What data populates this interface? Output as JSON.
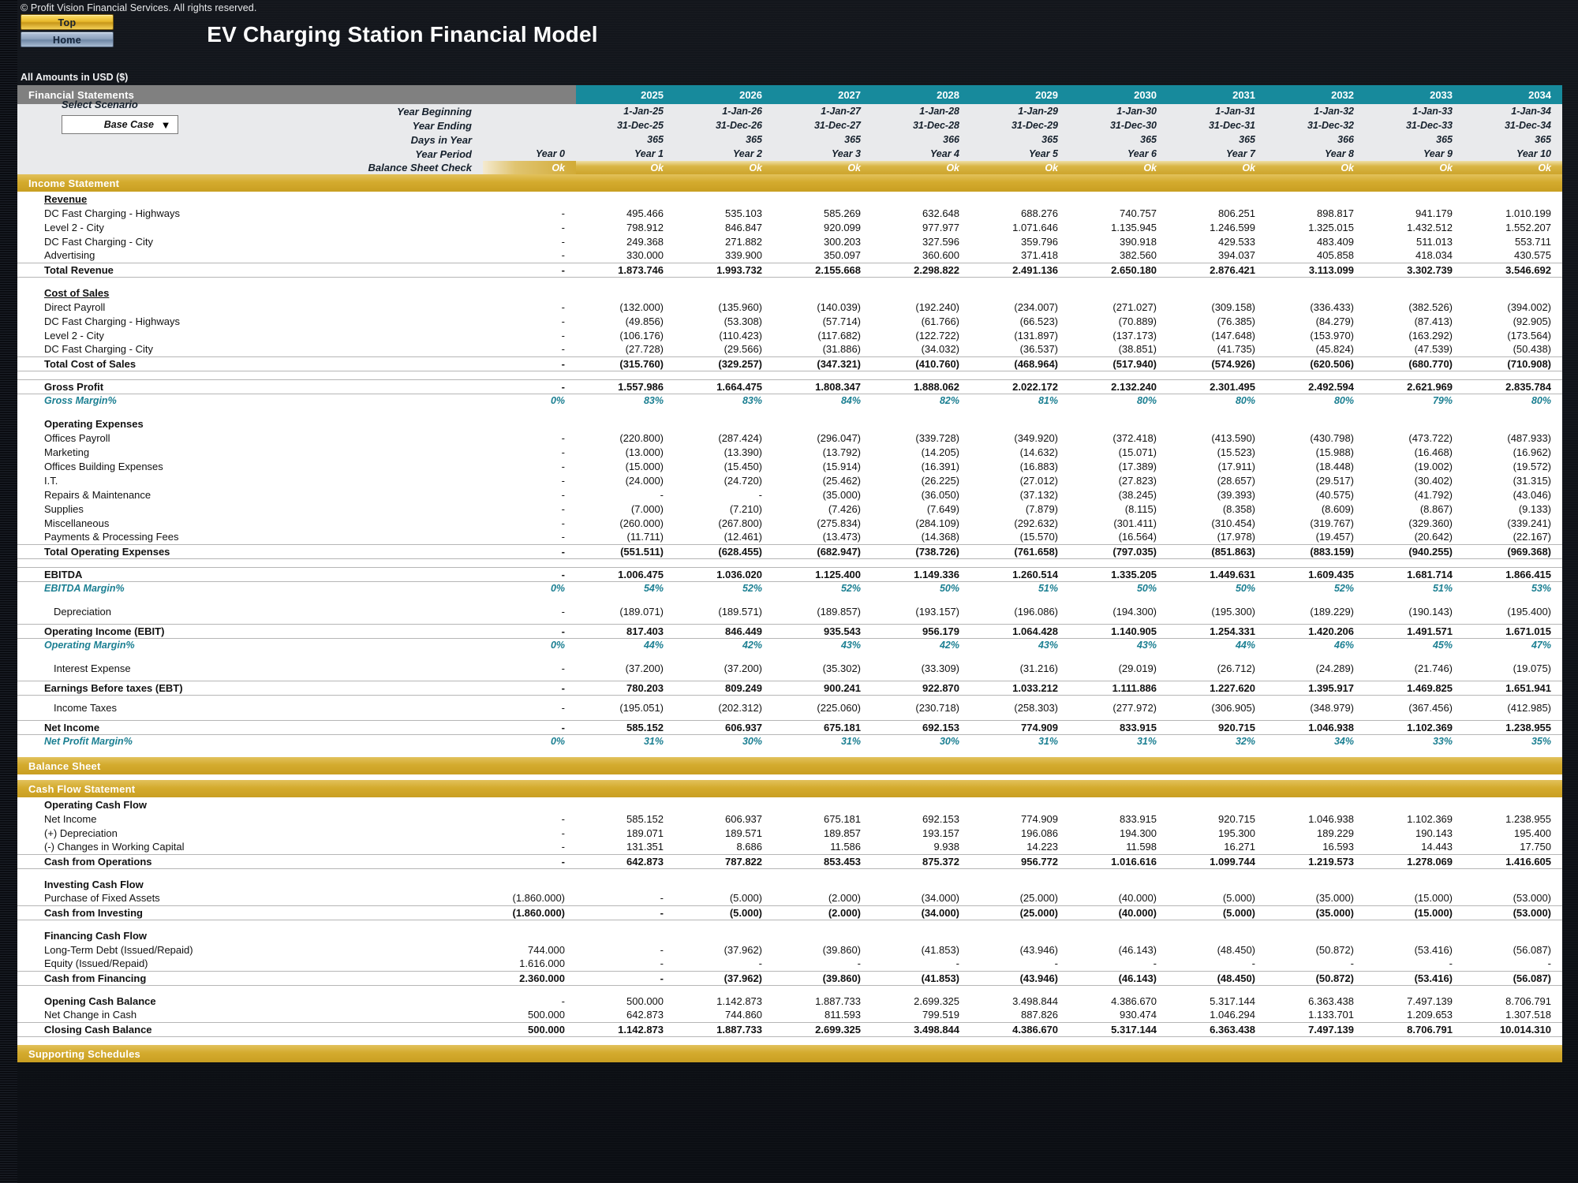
{
  "window": {
    "copyright": "© Profit Vision Financial Services. All rights reserved.",
    "title": "EV Charging Station Financial Model",
    "amounts_note": "All Amounts in  USD ($)"
  },
  "nav": {
    "top_label": "Top",
    "home_label": "Home"
  },
  "panel": {
    "heading": "Financial Statements",
    "scenario_label": "Select Scenario",
    "scenario_value": "Base Case",
    "dropdown_arrow": "▼"
  },
  "columns": {
    "years": [
      "2025",
      "2026",
      "2027",
      "2028",
      "2029",
      "2030",
      "2031",
      "2032",
      "2033",
      "2034"
    ]
  },
  "meta_rows": [
    {
      "label": "Year Beginning",
      "y0": "",
      "values": [
        "1-Jan-25",
        "1-Jan-26",
        "1-Jan-27",
        "1-Jan-28",
        "1-Jan-29",
        "1-Jan-30",
        "1-Jan-31",
        "1-Jan-32",
        "1-Jan-33",
        "1-Jan-34"
      ]
    },
    {
      "label": "Year Ending",
      "y0": "",
      "values": [
        "31-Dec-25",
        "31-Dec-26",
        "31-Dec-27",
        "31-Dec-28",
        "31-Dec-29",
        "31-Dec-30",
        "31-Dec-31",
        "31-Dec-32",
        "31-Dec-33",
        "31-Dec-34"
      ]
    },
    {
      "label": "Days in Year",
      "y0": "",
      "values": [
        "365",
        "365",
        "365",
        "366",
        "365",
        "365",
        "365",
        "366",
        "365",
        "365"
      ]
    },
    {
      "label": "Year Period",
      "y0": "Year 0",
      "values": [
        "Year 1",
        "Year 2",
        "Year 3",
        "Year 4",
        "Year 5",
        "Year 6",
        "Year 7",
        "Year 8",
        "Year 9",
        "Year 10"
      ]
    }
  ],
  "balance_check": {
    "label": "Balance Sheet Check",
    "y0": "Ok",
    "values": [
      "Ok",
      "Ok",
      "Ok",
      "Ok",
      "Ok",
      "Ok",
      "Ok",
      "Ok",
      "Ok",
      "Ok"
    ]
  },
  "sections": {
    "income_statement": "Income Statement",
    "balance_sheet": "Balance Sheet",
    "cash_flow": "Cash Flow Statement",
    "supporting": "Supporting Schedules"
  },
  "chart_data": {
    "type": "table",
    "title": "EV Charging Station Financial Model",
    "categories": [
      "2025",
      "2026",
      "2027",
      "2028",
      "2029",
      "2030",
      "2031",
      "2032",
      "2033",
      "2034"
    ],
    "series": [
      {
        "name": "Total Revenue",
        "values": [
          1873746,
          1993732,
          2155668,
          2298822,
          2491136,
          2650180,
          2876421,
          3113099,
          3302739,
          3546692
        ]
      },
      {
        "name": "Total Cost of Sales",
        "values": [
          -315760,
          -329257,
          -347321,
          -410760,
          -468964,
          -517940,
          -574926,
          -620506,
          -680770,
          -710908
        ]
      },
      {
        "name": "Gross Profit",
        "values": [
          1557986,
          1664475,
          1808347,
          1888062,
          2022172,
          2132240,
          2301495,
          2492594,
          2621969,
          2835784
        ]
      },
      {
        "name": "EBITDA",
        "values": [
          1006475,
          1036020,
          1125400,
          1149336,
          1260514,
          1335205,
          1449631,
          1609435,
          1681714,
          1866415
        ]
      },
      {
        "name": "Net Income",
        "values": [
          585152,
          606937,
          675181,
          692153,
          774909,
          833915,
          920715,
          1046938,
          1102369,
          1238955
        ]
      },
      {
        "name": "Closing Cash Balance",
        "values": [
          1142873,
          1887733,
          2699325,
          3498844,
          4386670,
          5317144,
          6363438,
          7497139,
          8706791,
          10014310
        ]
      }
    ]
  },
  "income_statement": {
    "revenue_header": "Revenue",
    "revenue_rows": [
      {
        "label": "DC Fast Charging - Highways",
        "y0": "-",
        "values": [
          "495.466",
          "535.103",
          "585.269",
          "632.648",
          "688.276",
          "740.757",
          "806.251",
          "898.817",
          "941.179",
          "1.010.199"
        ]
      },
      {
        "label": "Level 2 - City",
        "y0": "-",
        "values": [
          "798.912",
          "846.847",
          "920.099",
          "977.977",
          "1.071.646",
          "1.135.945",
          "1.246.599",
          "1.325.015",
          "1.432.512",
          "1.552.207"
        ]
      },
      {
        "label": "DC Fast Charging - City",
        "y0": "-",
        "values": [
          "249.368",
          "271.882",
          "300.203",
          "327.596",
          "359.796",
          "390.918",
          "429.533",
          "483.409",
          "511.013",
          "553.711"
        ]
      },
      {
        "label": "Advertising",
        "y0": "-",
        "values": [
          "330.000",
          "339.900",
          "350.097",
          "360.600",
          "371.418",
          "382.560",
          "394.037",
          "405.858",
          "418.034",
          "430.575"
        ]
      }
    ],
    "total_revenue": {
      "label": "Total Revenue",
      "y0": "-",
      "values": [
        "1.873.746",
        "1.993.732",
        "2.155.668",
        "2.298.822",
        "2.491.136",
        "2.650.180",
        "2.876.421",
        "3.113.099",
        "3.302.739",
        "3.546.692"
      ]
    },
    "cos_header": "Cost of Sales",
    "cos_rows": [
      {
        "label": "Direct Payroll",
        "y0": "-",
        "values": [
          "(132.000)",
          "(135.960)",
          "(140.039)",
          "(192.240)",
          "(234.007)",
          "(271.027)",
          "(309.158)",
          "(336.433)",
          "(382.526)",
          "(394.002)"
        ]
      },
      {
        "label": "DC Fast Charging - Highways",
        "y0": "-",
        "values": [
          "(49.856)",
          "(53.308)",
          "(57.714)",
          "(61.766)",
          "(66.523)",
          "(70.889)",
          "(76.385)",
          "(84.279)",
          "(87.413)",
          "(92.905)"
        ]
      },
      {
        "label": "Level 2 - City",
        "y0": "-",
        "values": [
          "(106.176)",
          "(110.423)",
          "(117.682)",
          "(122.722)",
          "(131.897)",
          "(137.173)",
          "(147.648)",
          "(153.970)",
          "(163.292)",
          "(173.564)"
        ]
      },
      {
        "label": "DC Fast Charging - City",
        "y0": "-",
        "values": [
          "(27.728)",
          "(29.566)",
          "(31.886)",
          "(34.032)",
          "(36.537)",
          "(38.851)",
          "(41.735)",
          "(45.824)",
          "(47.539)",
          "(50.438)"
        ]
      }
    ],
    "total_cos": {
      "label": "Total Cost of Sales",
      "y0": "-",
      "values": [
        "(315.760)",
        "(329.257)",
        "(347.321)",
        "(410.760)",
        "(468.964)",
        "(517.940)",
        "(574.926)",
        "(620.506)",
        "(680.770)",
        "(710.908)"
      ]
    },
    "gross_profit": {
      "label": "Gross Profit",
      "y0": "-",
      "values": [
        "1.557.986",
        "1.664.475",
        "1.808.347",
        "1.888.062",
        "2.022.172",
        "2.132.240",
        "2.301.495",
        "2.492.594",
        "2.621.969",
        "2.835.784"
      ]
    },
    "gross_margin": {
      "label": "Gross Margin%",
      "y0": "0%",
      "values": [
        "83%",
        "83%",
        "84%",
        "82%",
        "81%",
        "80%",
        "80%",
        "80%",
        "79%",
        "80%"
      ]
    },
    "opex_header": "Operating Expenses",
    "opex_rows": [
      {
        "label": "Offices Payroll",
        "y0": "-",
        "values": [
          "(220.800)",
          "(287.424)",
          "(296.047)",
          "(339.728)",
          "(349.920)",
          "(372.418)",
          "(413.590)",
          "(430.798)",
          "(473.722)",
          "(487.933)"
        ]
      },
      {
        "label": "Marketing",
        "y0": "-",
        "values": [
          "(13.000)",
          "(13.390)",
          "(13.792)",
          "(14.205)",
          "(14.632)",
          "(15.071)",
          "(15.523)",
          "(15.988)",
          "(16.468)",
          "(16.962)"
        ]
      },
      {
        "label": "Offices Building Expenses",
        "y0": "-",
        "values": [
          "(15.000)",
          "(15.450)",
          "(15.914)",
          "(16.391)",
          "(16.883)",
          "(17.389)",
          "(17.911)",
          "(18.448)",
          "(19.002)",
          "(19.572)"
        ]
      },
      {
        "label": "I.T.",
        "y0": "-",
        "values": [
          "(24.000)",
          "(24.720)",
          "(25.462)",
          "(26.225)",
          "(27.012)",
          "(27.823)",
          "(28.657)",
          "(29.517)",
          "(30.402)",
          "(31.315)"
        ]
      },
      {
        "label": "Repairs & Maintenance",
        "y0": "-",
        "values": [
          "-",
          "-",
          "(35.000)",
          "(36.050)",
          "(37.132)",
          "(38.245)",
          "(39.393)",
          "(40.575)",
          "(41.792)",
          "(43.046)"
        ]
      },
      {
        "label": "Supplies",
        "y0": "-",
        "values": [
          "(7.000)",
          "(7.210)",
          "(7.426)",
          "(7.649)",
          "(7.879)",
          "(8.115)",
          "(8.358)",
          "(8.609)",
          "(8.867)",
          "(9.133)"
        ]
      },
      {
        "label": "Miscellaneous",
        "y0": "-",
        "values": [
          "(260.000)",
          "(267.800)",
          "(275.834)",
          "(284.109)",
          "(292.632)",
          "(301.411)",
          "(310.454)",
          "(319.767)",
          "(329.360)",
          "(339.241)"
        ]
      },
      {
        "label": "Payments & Processing Fees",
        "y0": "-",
        "values": [
          "(11.711)",
          "(12.461)",
          "(13.473)",
          "(14.368)",
          "(15.570)",
          "(16.564)",
          "(17.978)",
          "(19.457)",
          "(20.642)",
          "(22.167)"
        ]
      }
    ],
    "total_opex": {
      "label": "Total Operating Expenses",
      "y0": "-",
      "values": [
        "(551.511)",
        "(628.455)",
        "(682.947)",
        "(738.726)",
        "(761.658)",
        "(797.035)",
        "(851.863)",
        "(883.159)",
        "(940.255)",
        "(969.368)"
      ]
    },
    "ebitda": {
      "label": "EBITDA",
      "y0": "-",
      "values": [
        "1.006.475",
        "1.036.020",
        "1.125.400",
        "1.149.336",
        "1.260.514",
        "1.335.205",
        "1.449.631",
        "1.609.435",
        "1.681.714",
        "1.866.415"
      ]
    },
    "ebitda_margin": {
      "label": "EBITDA Margin%",
      "y0": "0%",
      "values": [
        "54%",
        "52%",
        "52%",
        "50%",
        "51%",
        "50%",
        "50%",
        "52%",
        "51%",
        "53%"
      ]
    },
    "depreciation": {
      "label": "Depreciation",
      "y0": "-",
      "values": [
        "(189.071)",
        "(189.571)",
        "(189.857)",
        "(193.157)",
        "(196.086)",
        "(194.300)",
        "(195.300)",
        "(189.229)",
        "(190.143)",
        "(195.400)"
      ]
    },
    "ebit": {
      "label": "Operating Income (EBIT)",
      "y0": "-",
      "values": [
        "817.403",
        "846.449",
        "935.543",
        "956.179",
        "1.064.428",
        "1.140.905",
        "1.254.331",
        "1.420.206",
        "1.491.571",
        "1.671.015"
      ]
    },
    "operating_margin": {
      "label": "Operating Margin%",
      "y0": "0%",
      "values": [
        "44%",
        "42%",
        "43%",
        "42%",
        "43%",
        "43%",
        "44%",
        "46%",
        "45%",
        "47%"
      ]
    },
    "interest_expense": {
      "label": "Interest Expense",
      "y0": "-",
      "values": [
        "(37.200)",
        "(37.200)",
        "(35.302)",
        "(33.309)",
        "(31.216)",
        "(29.019)",
        "(26.712)",
        "(24.289)",
        "(21.746)",
        "(19.075)"
      ]
    },
    "ebt": {
      "label": "Earnings Before taxes (EBT)",
      "y0": "-",
      "values": [
        "780.203",
        "809.249",
        "900.241",
        "922.870",
        "1.033.212",
        "1.111.886",
        "1.227.620",
        "1.395.917",
        "1.469.825",
        "1.651.941"
      ]
    },
    "income_taxes": {
      "label": "Income Taxes",
      "y0": "-",
      "values": [
        "(195.051)",
        "(202.312)",
        "(225.060)",
        "(230.718)",
        "(258.303)",
        "(277.972)",
        "(306.905)",
        "(348.979)",
        "(367.456)",
        "(412.985)"
      ]
    },
    "net_income": {
      "label": "Net Income",
      "y0": "-",
      "values": [
        "585.152",
        "606.937",
        "675.181",
        "692.153",
        "774.909",
        "833.915",
        "920.715",
        "1.046.938",
        "1.102.369",
        "1.238.955"
      ]
    },
    "net_margin": {
      "label": "Net Profit Margin%",
      "y0": "0%",
      "values": [
        "31%",
        "30%",
        "31%",
        "30%",
        "31%",
        "31%",
        "32%",
        "34%",
        "33%",
        "35%"
      ]
    }
  },
  "cash_flow": {
    "operating_header": "Operating Cash Flow",
    "operating_rows": [
      {
        "label": "Net Income",
        "y0": "-",
        "values": [
          "585.152",
          "606.937",
          "675.181",
          "692.153",
          "774.909",
          "833.915",
          "920.715",
          "1.046.938",
          "1.102.369",
          "1.238.955"
        ]
      },
      {
        "label": "(+) Depreciation",
        "y0": "-",
        "values": [
          "189.071",
          "189.571",
          "189.857",
          "193.157",
          "196.086",
          "194.300",
          "195.300",
          "189.229",
          "190.143",
          "195.400"
        ]
      },
      {
        "label": "(-) Changes in Working Capital",
        "y0": "-",
        "values": [
          "131.351",
          "8.686",
          "11.586",
          "9.938",
          "14.223",
          "11.598",
          "16.271",
          "16.593",
          "14.443",
          "17.750"
        ]
      }
    ],
    "cash_from_operations": {
      "label": "Cash from Operations",
      "y0": "-",
      "values": [
        "642.873",
        "787.822",
        "853.453",
        "875.372",
        "956.772",
        "1.016.616",
        "1.099.744",
        "1.219.573",
        "1.278.069",
        "1.416.605"
      ]
    },
    "investing_header": "Investing Cash Flow",
    "investing_rows": [
      {
        "label": "Purchase of Fixed Assets",
        "y0": "(1.860.000)",
        "values": [
          "-",
          "(5.000)",
          "(2.000)",
          "(34.000)",
          "(25.000)",
          "(40.000)",
          "(5.000)",
          "(35.000)",
          "(15.000)",
          "(53.000)"
        ]
      }
    ],
    "cash_from_investing": {
      "label": "Cash from Investing",
      "y0": "(1.860.000)",
      "values": [
        "-",
        "(5.000)",
        "(2.000)",
        "(34.000)",
        "(25.000)",
        "(40.000)",
        "(5.000)",
        "(35.000)",
        "(15.000)",
        "(53.000)"
      ]
    },
    "financing_header": "Financing Cash Flow",
    "financing_rows": [
      {
        "label": "Long-Term Debt (Issued/Repaid)",
        "y0": "744.000",
        "values": [
          "-",
          "(37.962)",
          "(39.860)",
          "(41.853)",
          "(43.946)",
          "(46.143)",
          "(48.450)",
          "(50.872)",
          "(53.416)",
          "(56.087)"
        ]
      },
      {
        "label": "Equity (Issued/Repaid)",
        "y0": "1.616.000",
        "values": [
          "-",
          "-",
          "-",
          "-",
          "-",
          "-",
          "-",
          "-",
          "-",
          "-"
        ]
      }
    ],
    "cash_from_financing": {
      "label": "Cash from Financing",
      "y0": "2.360.000",
      "values": [
        "-",
        "(37.962)",
        "(39.860)",
        "(41.853)",
        "(43.946)",
        "(46.143)",
        "(48.450)",
        "(50.872)",
        "(53.416)",
        "(56.087)"
      ]
    },
    "opening_cash": {
      "label": "Opening Cash Balance",
      "y0": "-",
      "values": [
        "500.000",
        "1.142.873",
        "1.887.733",
        "2.699.325",
        "3.498.844",
        "4.386.670",
        "5.317.144",
        "6.363.438",
        "7.497.139",
        "8.706.791"
      ]
    },
    "net_change": {
      "label": "Net Change in Cash",
      "y0": "500.000",
      "values": [
        "642.873",
        "744.860",
        "811.593",
        "799.519",
        "887.826",
        "930.474",
        "1.046.294",
        "1.133.701",
        "1.209.653",
        "1.307.518"
      ]
    },
    "closing_cash": {
      "label": "Closing Cash Balance",
      "y0": "500.000",
      "values": [
        "1.142.873",
        "1.887.733",
        "2.699.325",
        "3.498.844",
        "4.386.670",
        "5.317.144",
        "6.363.438",
        "7.497.139",
        "8.706.791",
        "10.014.310"
      ]
    }
  }
}
